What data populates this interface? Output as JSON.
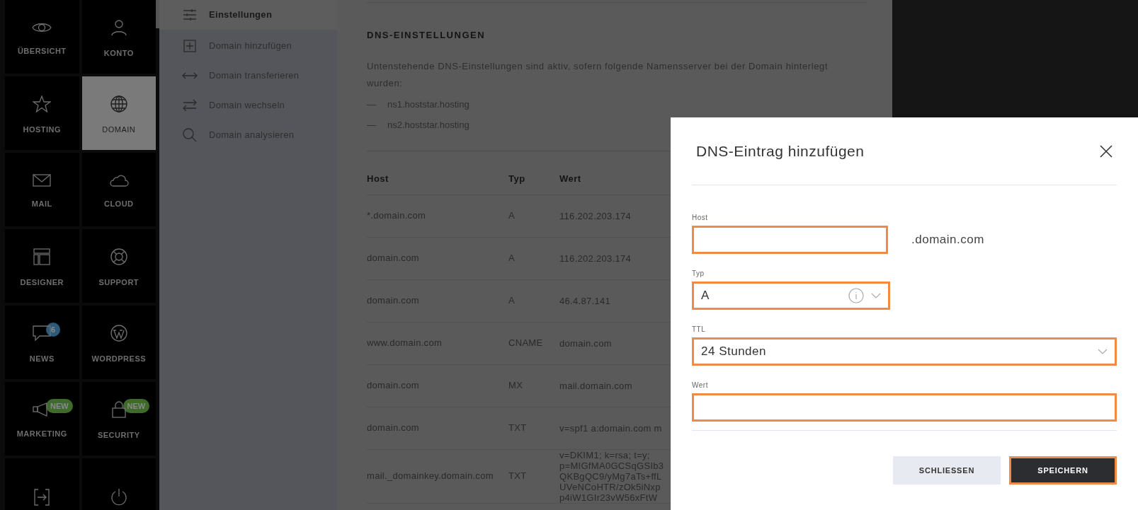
{
  "sidebar": {
    "items": [
      {
        "label": "ÜBERSICHT",
        "selected": false
      },
      {
        "label": "KONTO",
        "selected": false
      },
      {
        "label": "HOSTING",
        "selected": false
      },
      {
        "label": "DOMAIN",
        "selected": true
      },
      {
        "label": "MAIL",
        "selected": false
      },
      {
        "label": "CLOUD",
        "selected": false
      },
      {
        "label": "DESIGNER",
        "selected": false
      },
      {
        "label": "SUPPORT",
        "selected": false
      },
      {
        "label": "NEWS",
        "selected": false,
        "badge": {
          "text": "6",
          "color": "#2c5a78"
        }
      },
      {
        "label": "WORDPRESS",
        "selected": false
      },
      {
        "label": "MARKETING",
        "selected": false,
        "badge": {
          "text": "NEW",
          "color": "#3e6b2a"
        }
      },
      {
        "label": "SECURITY",
        "selected": false,
        "badge": {
          "text": "NEW",
          "color": "#3e6b2a"
        }
      },
      {
        "selected": false
      },
      {
        "selected": false
      }
    ]
  },
  "submenu": {
    "items": [
      {
        "label": "Einstellungen",
        "selected": true
      },
      {
        "label": "Domain hinzufügen",
        "selected": false
      },
      {
        "label": "Domain transferieren",
        "selected": false
      },
      {
        "label": "Domain wechseln",
        "selected": false
      },
      {
        "label": "Domain analysieren",
        "selected": false
      }
    ]
  },
  "content": {
    "heading": "DNS-EINSTELLUNGEN",
    "description": "Untenstehende DNS-Einstellungen sind aktiv, sofern folgende Namensserver bei der Domain hinterlegt wurden:",
    "nameservers": [
      {
        "dash": "—",
        "name": "ns1.hoststar.hosting"
      },
      {
        "dash": "—",
        "name": "ns2.hoststar.hosting"
      }
    ],
    "table": {
      "columns": [
        "Host",
        "Typ",
        "Wert"
      ],
      "rows": [
        {
          "host": "*.domain.com",
          "type": "A",
          "value": [
            "116.202.203.174"
          ]
        },
        {
          "host": "domain.com",
          "type": "A",
          "value": [
            "116.202.203.174"
          ]
        },
        {
          "host": "domain.com",
          "type": "A",
          "value": [
            "46.4.87.141"
          ]
        },
        {
          "host": "www.domain.com",
          "type": "CNAME",
          "value": [
            "domain.com"
          ]
        },
        {
          "host": "domain.com",
          "type": "MX",
          "value": [
            "mail.domain.com"
          ]
        },
        {
          "host": "domain.com",
          "type": "TXT",
          "value": [
            "v=spf1 a:domain.com m"
          ]
        },
        {
          "host": "mail._domainkey.domain.com",
          "type": "TXT",
          "value": [
            "v=DKIM1; k=rsa; t=y;",
            "p=MIGfMA0GCSqGSIb3",
            "QKBgQC9/yMg7aTs+ffL",
            "UVeNCoHTR/zOk5iNxp",
            "p4iW1GIr23vW56xFtW"
          ]
        }
      ]
    }
  },
  "modal": {
    "title": "DNS-Eintrag hinzufügen",
    "fields": [
      {
        "kind": "input",
        "label": "Host",
        "suffix": ".domain.com"
      },
      {
        "kind": "select",
        "label": "Typ",
        "value": "A",
        "info": true
      },
      {
        "kind": "select",
        "label": "TTL",
        "value": "24 Stunden",
        "info": false
      },
      {
        "kind": "input",
        "label": "Wert"
      }
    ],
    "buttons": [
      {
        "label": "SCHLIESSEN",
        "primary": false
      },
      {
        "label": "SPEICHERN",
        "primary": true
      }
    ]
  }
}
